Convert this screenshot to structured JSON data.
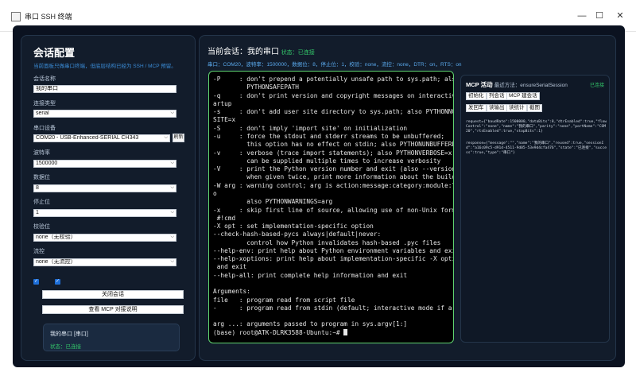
{
  "window": {
    "title": "串口 SSH 终端",
    "minimize_glyph": "—",
    "maximize_glyph": "☐",
    "close_glyph": "✕"
  },
  "left": {
    "heading": "会话配置",
    "subtitle": "当前面板只做串口终端，但底层结构已经为 SSH / MCP 预留。",
    "session_name_label": "会话名称",
    "session_name_value": "我的串口",
    "conn_type_label": "连接类型",
    "conn_type_value": "serial",
    "serial_device_label": "串口设备",
    "serial_device_value": "COM20 - USB-Enhanced-SERIAL CH343",
    "refresh_label": "刷新",
    "baud_label": "波特率",
    "baud_value": "1500000",
    "data_bits_label": "数据位",
    "data_bits_value": "8",
    "stop_bits_label": "停止位",
    "stop_bits_value": "1",
    "parity_label": "校验位",
    "parity_value": "none（无校验）",
    "flow_label": "流控",
    "flow_value": "none（无流控）",
    "close_session_label": "关闭会话",
    "mcp_help_label": "查看 MCP 对接说明",
    "session_card": {
      "name": "我的串口 [串口]",
      "status": "状态：已连接"
    }
  },
  "right": {
    "current_session": "当前会话：我的串口",
    "status": "状态：已连接",
    "info": "串口：COM20，波特率：1500000，数据位：8，停止位：1，校验：none，流控：none，DTR：on，RTS：on"
  },
  "terminal": {
    "lines": [
      "-P     : don't prepend a potentially unsafe path to sys.path; also",
      "         PYTHONSAFEPATH",
      "-q     : don't print version and copyright messages on interactive st",
      "artup",
      "-s     : don't add user site directory to sys.path; also PYTHONNOUSER",
      "SITE=x",
      "-S     : don't imply 'import site' on initialization",
      "-u     : force the stdout and stderr streams to be unbuffered;",
      "         this option has no effect on stdin; also PYTHONUNBUFFERED=x",
      "-v     : verbose (trace import statements); also PYTHONVERBOSE=x",
      "         can be supplied multiple times to increase verbosity",
      "-V     : print the Python version number and exit (also --version)",
      "         when given twice, print more information about the build",
      "-W arg : warning control; arg is action:message:category:module:lineno",
      "o",
      "         also PYTHONWARNINGS=arg",
      "-x     : skip first line of source, allowing use of non-Unix forms of",
      " #!cmd",
      "-X opt : set implementation-specific option",
      "--check-hash-based-pycs always|default|never:",
      "         control how Python invalidates hash-based .pyc files",
      "--help-env: print help about Python environment variables and exit",
      "--help-xoptions: print help about implementation-specific -X options",
      " and exit",
      "--help-all: print complete help information and exit",
      "",
      "Arguments:",
      "file   : program read from script file",
      "-      : program read from stdin (default; interactive mode if a tty)",
      "",
      "arg ...: arguments passed to program in sys.argv[1:]"
    ],
    "prompt": "(base) root@ATK-DLRK3588-Ubuntu:~# "
  },
  "mcp": {
    "title": "MCP 活动",
    "meta": "最近方法：ensureSerialSession",
    "status": "已连接",
    "buttons": [
      "初始化",
      "列会话",
      "MCP 建会话",
      "发回车",
      "读输出",
      "读统计",
      "截图"
    ],
    "request_text": "request={\"baudRate\":1500000,\"dataBits\":8,\"dtrEnabled\":true,\"flowControl\":\"none\",\"name\":\"我的串口\",\"parity\":\"none\",\"portName\":\"COM20\",\"rtsEnabled\":true,\"stopBits\":1}",
    "response_text": "response={\"message\":\"\",\"name\":\"我的串口\",\"reused\":true,\"sessionId\":\"a16c09c5-d91d-4511-9d05-53e9d4cfa476\",\"state\":\"已连接\",\"success\":true,\"type\":\"串口\"}"
  }
}
